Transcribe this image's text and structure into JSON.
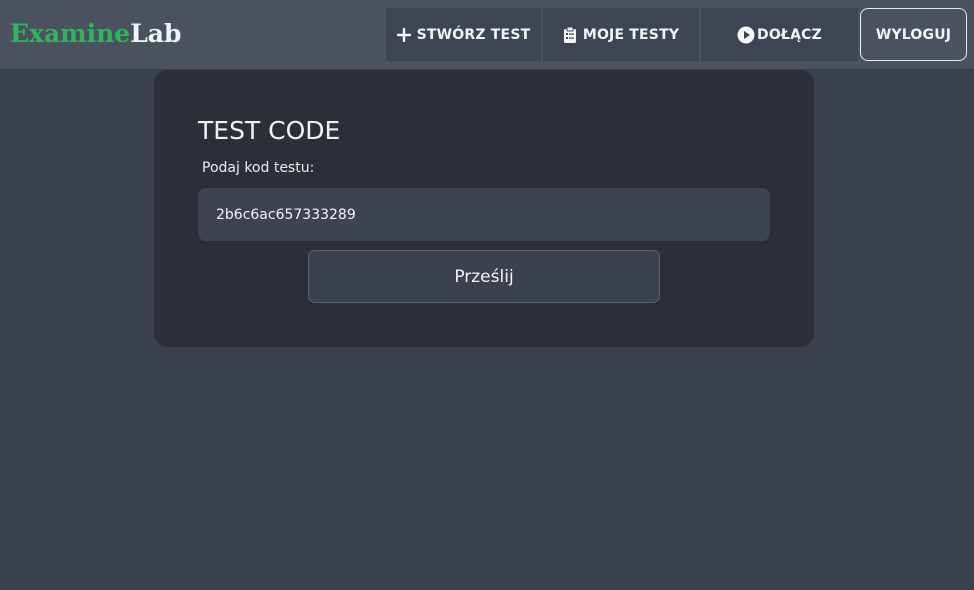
{
  "brand": {
    "part1": "Examine",
    "part2": "Lab"
  },
  "nav": {
    "create": {
      "label": "STWÓRZ TEST",
      "icon": "plus-icon"
    },
    "my_tests": {
      "label": "MOJE TESTY",
      "icon": "clipboard-icon"
    },
    "join": {
      "label": "DOŁĄCZ",
      "icon": "play-circle-icon"
    },
    "logout": {
      "label": "WYLOGUJ"
    }
  },
  "form": {
    "title": "TEST CODE",
    "label": "Podaj kod testu:",
    "code_value": "2b6c6ac657333289",
    "submit_label": "Prześlij"
  },
  "colors": {
    "background": "#3a414d",
    "navbar": "#4a5260",
    "card": "#2b3038",
    "brand_green": "#2fb55a"
  }
}
